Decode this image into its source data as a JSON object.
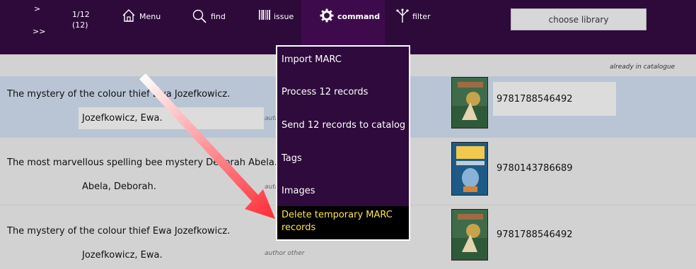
{
  "topbar": {
    "arrow_forward": ">",
    "arrow_double": ">>",
    "count_line1": "1/12",
    "count_line2": "(12)",
    "menu_label": "Menu",
    "find_label": "find",
    "issue_label": "issue",
    "command_label": "command",
    "filter_label": "filter",
    "choose_library": "choose library"
  },
  "header": {
    "already_in_catalogue": "already in catalogue"
  },
  "records": [
    {
      "title": "The mystery of the colour thief Ewa Jozefkowicz.",
      "author": "Jozefkowicz, Ewa.",
      "author_other": "author other",
      "isbn": "9781788546492",
      "cover": "colour-thief-cover"
    },
    {
      "title": "The most marvellous spelling bee mystery Deborah Abela.",
      "author": "Abela, Deborah.",
      "author_other": "author other",
      "isbn": "9780143786689",
      "cover": "spelling-bee-cover"
    },
    {
      "title": "The mystery of the colour thief Ewa Jozefkowicz.",
      "author": "Jozefkowicz, Ewa.",
      "author_other": "author other",
      "isbn": "9781788546492",
      "cover": "colour-thief-cover"
    }
  ],
  "command_menu": {
    "items": [
      "Import MARC",
      "Process 12 records",
      "Send 12 records to catalog",
      "Tags",
      "Images"
    ],
    "highlighted_line1": "Delete temporary MARC",
    "highlighted_line2": "records"
  },
  "colors": {
    "topbar": "#2e0a3b",
    "menu_bg": "#2f0a3c",
    "highlight_bg": "#000000",
    "highlight_text": "#ffe34c",
    "annotation_arrow": "#ff2b35"
  }
}
